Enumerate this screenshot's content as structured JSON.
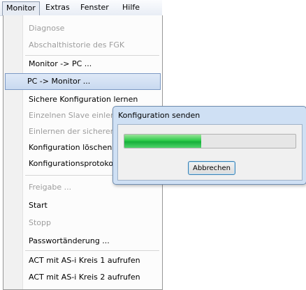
{
  "menubar": {
    "items": [
      {
        "label": "Monitor"
      },
      {
        "label": "Extras"
      },
      {
        "label": "Fenster"
      },
      {
        "label": "Hilfe"
      }
    ]
  },
  "menu": {
    "items": [
      {
        "label": "Diagnose",
        "disabled": true
      },
      {
        "label": "Abschalthistorie des FGK",
        "disabled": true
      },
      {
        "label": "Monitor -> PC ...",
        "disabled": false
      },
      {
        "label": "PC -> Monitor ...",
        "disabled": false,
        "highlighted": true
      },
      {
        "label": "Sichere Konfiguration lernen",
        "disabled": false
      },
      {
        "label": "Einzelnen Slave einlernen",
        "disabled": true
      },
      {
        "label": "Einlernen der sicheren Ko",
        "disabled": true
      },
      {
        "label": "Konfiguration löschen",
        "disabled": false
      },
      {
        "label": "Konfigurationsprotokoll",
        "disabled": false
      },
      {
        "label": "Freigabe ...",
        "disabled": true
      },
      {
        "label": "Start",
        "disabled": false
      },
      {
        "label": "Stopp",
        "disabled": true
      },
      {
        "label": "Passwortänderung ...",
        "disabled": false
      },
      {
        "label": "ACT mit AS-i Kreis 1 aufrufen",
        "disabled": false
      },
      {
        "label": "ACT mit AS-i Kreis 2 aufrufen",
        "disabled": false
      }
    ]
  },
  "dialog": {
    "title": "Konfiguration senden",
    "progress": 0.45,
    "cancel_label": "Abbrechen"
  },
  "colors": {
    "highlight_border": "#7b98c4",
    "progress_green": "#16b03a",
    "disabled_text": "#9d9d9d"
  }
}
